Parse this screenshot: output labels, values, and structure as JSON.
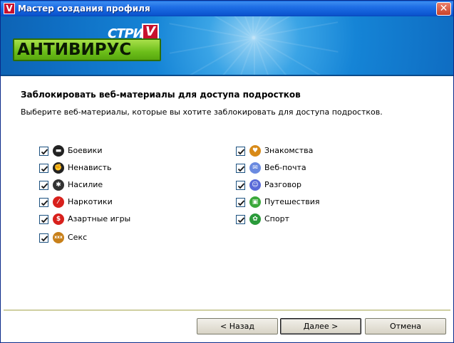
{
  "window": {
    "title": "Мастер создания профиля",
    "close_glyph": "✕"
  },
  "banner": {
    "logo_top": "СТРИ",
    "logo_badge": "V",
    "logo_main": "АНТИВИРУС",
    "colors": {
      "sky": "#1584d6",
      "logo_green": "#6cbe1a",
      "badge_red": "#c8102e"
    }
  },
  "content": {
    "heading": "Заблокировать веб-материалы для доступа подростков",
    "subtitle": "Выберите веб-материалы, которые вы хотите заблокировать для доступа подростков."
  },
  "categories_left": [
    {
      "label": "Боевики",
      "icon": "gun-icon",
      "color": "#222222",
      "glyph": "▬",
      "checked": true
    },
    {
      "label": "Ненависть",
      "icon": "fist-icon",
      "color": "#222222",
      "glyph": "✊",
      "checked": true
    },
    {
      "label": "Насилие",
      "icon": "violence-icon",
      "color": "#333333",
      "glyph": "✱",
      "checked": true
    },
    {
      "label": "Наркотики",
      "icon": "syringe-icon",
      "color": "#d8201c",
      "glyph": "⁄",
      "checked": true
    },
    {
      "label": "Азартные игры",
      "icon": "dollar-icon",
      "color": "#d8201c",
      "glyph": "$",
      "checked": true
    },
    {
      "label": "Секс",
      "icon": "xxx-icon",
      "color": "#c8801a",
      "glyph": "xxx",
      "checked": true
    }
  ],
  "categories_right": [
    {
      "label": "Знакомства",
      "icon": "dating-icon",
      "color": "#d88a18",
      "glyph": "♥",
      "checked": true
    },
    {
      "label": "Веб-почта",
      "icon": "mail-icon",
      "color": "#6a8ae0",
      "glyph": "✉",
      "checked": true
    },
    {
      "label": "Разговор",
      "icon": "chat-icon",
      "color": "#5a6ad8",
      "glyph": "☺",
      "checked": true
    },
    {
      "label": "Путешествия",
      "icon": "travel-icon",
      "color": "#3aa83a",
      "glyph": "▣",
      "checked": true
    },
    {
      "label": "Спорт",
      "icon": "sport-icon",
      "color": "#2a9a3a",
      "glyph": "✿",
      "checked": true
    }
  ],
  "buttons": {
    "back": "< Назад",
    "next": "Далее >",
    "cancel": "Отмена"
  }
}
